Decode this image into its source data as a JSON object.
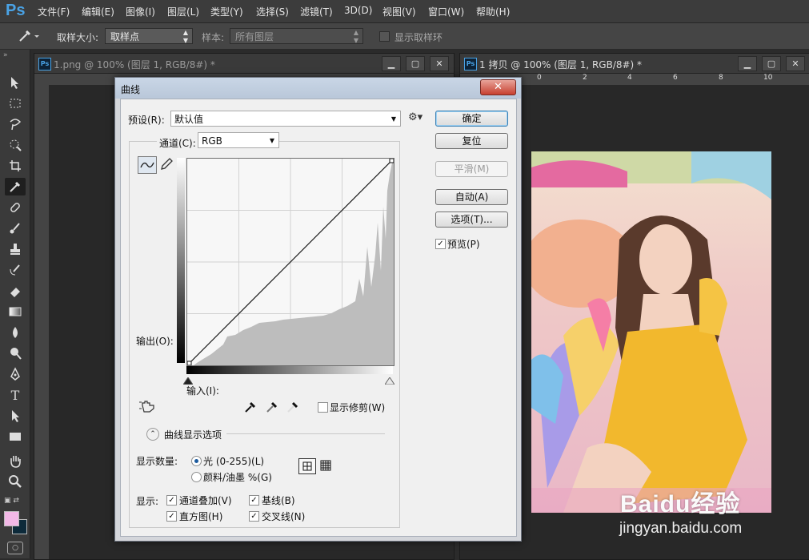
{
  "app": {
    "logo": "Ps",
    "menu": [
      "文件(F)",
      "编辑(E)",
      "图像(I)",
      "图层(L)",
      "类型(Y)",
      "选择(S)",
      "滤镜(T)",
      "3D(D)",
      "视图(V)",
      "窗口(W)",
      "帮助(H)"
    ]
  },
  "options_bar": {
    "sample_size_label": "取样大小:",
    "sample_size_value": "取样点",
    "sample_label": "样本:",
    "sample_value": "所有图层",
    "show_ring_label": "显示取样环"
  },
  "documents": [
    {
      "title": "1.png @ 100% (图层 1, RGB/8#) *",
      "icon": "Ps"
    },
    {
      "title": "1 拷贝 @ 100% (图层 1, RGB/8#) *",
      "icon": "Ps",
      "ruler_labels": [
        "0",
        "2",
        "4",
        "6",
        "8",
        "10"
      ]
    }
  ],
  "dialog": {
    "title": "曲线",
    "close": "✕",
    "preset_label": "预设(R):",
    "preset_value": "默认值",
    "channel_label": "通道(C):",
    "channel_value": "RGB",
    "output_label": "输出(O):",
    "input_label": "输入(I):",
    "show_clipping": "显示修剪(W)",
    "display_options_label": "曲线显示选项",
    "show_amount_label": "显示数量:",
    "amount_light": "光 (0-255)(L)",
    "amount_pigment": "颜料/油墨 %(G)",
    "show_label": "显示:",
    "opt_channel_overlay": "通道叠加(V)",
    "opt_baseline": "基线(B)",
    "opt_histogram": "直方图(H)",
    "opt_intersection": "交叉线(N)",
    "buttons": {
      "ok": "确定",
      "reset": "复位",
      "smooth": "平滑(M)",
      "auto": "自动(A)",
      "options": "选项(T)..."
    },
    "preview_label": "预览(P)",
    "checks": {
      "show_clipping": false,
      "preview": true,
      "channel_overlay": true,
      "baseline": true,
      "histogram": true,
      "intersection": true
    }
  },
  "watermark": {
    "brand": "Baidu经验",
    "url": "jingyan.baidu.com"
  },
  "colors": {
    "foreground": "#f2b8e6",
    "background": "#0d2a3a"
  }
}
